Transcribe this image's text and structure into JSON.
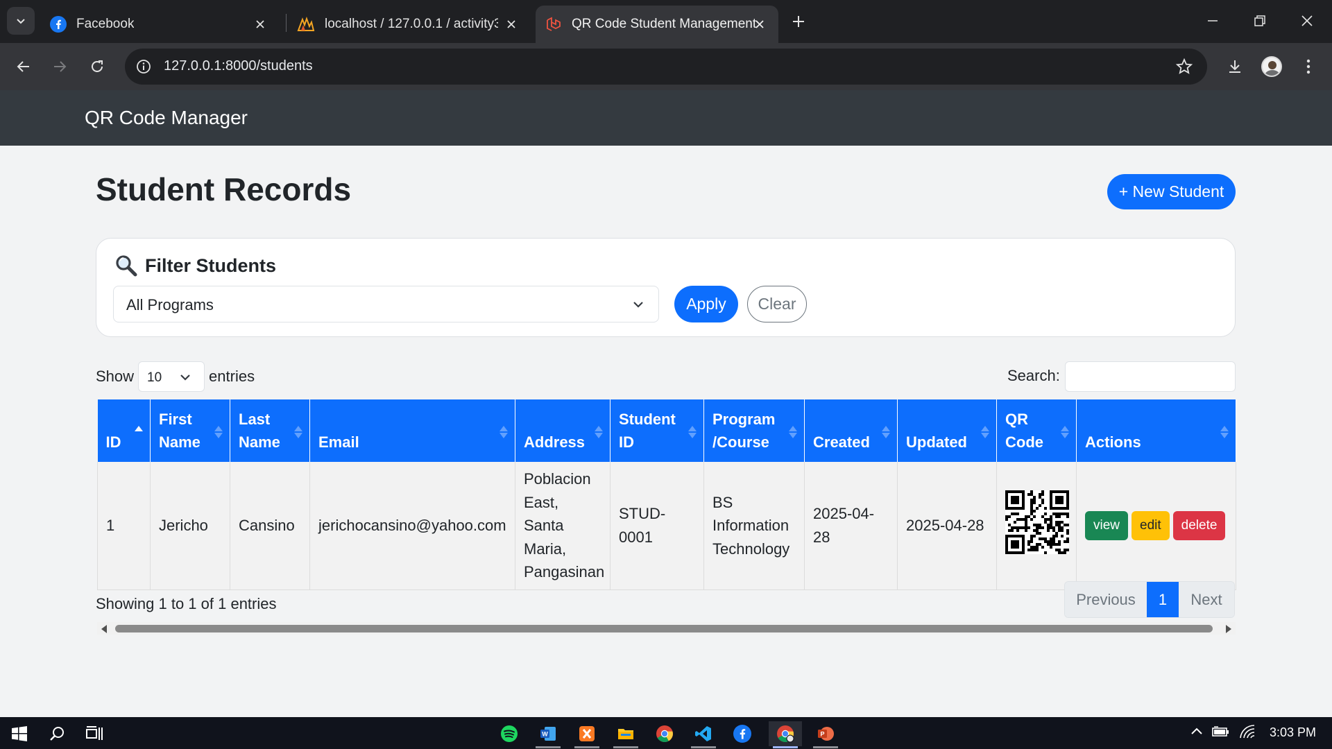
{
  "browser": {
    "tabs": [
      {
        "title": "Facebook",
        "icon": "facebook-icon"
      },
      {
        "title": "localhost / 127.0.0.1 / activity3_",
        "icon": "phpmyadmin-icon"
      },
      {
        "title": "QR Code Student Management",
        "icon": "laravel-icon",
        "active": true
      }
    ],
    "url": "127.0.0.1:8000/students"
  },
  "app": {
    "brand": "QR Code Manager",
    "page_title": "Student Records",
    "new_button": "+ New Student",
    "filter": {
      "title": "Filter Students",
      "icon": "magnifier-icon",
      "program_selected": "All Programs",
      "apply_label": "Apply",
      "clear_label": "Clear"
    },
    "length": {
      "show_label": "Show",
      "value": "10",
      "entries_label": "entries"
    },
    "search_label": "Search:",
    "table": {
      "columns": [
        {
          "line1": "",
          "line2": "ID"
        },
        {
          "line1": "First",
          "line2": "Name"
        },
        {
          "line1": "Last",
          "line2": "Name"
        },
        {
          "line1": "",
          "line2": "Email"
        },
        {
          "line1": "",
          "line2": "Address"
        },
        {
          "line1": "Student",
          "line2": "ID"
        },
        {
          "line1": "Program",
          "line2": "/Course"
        },
        {
          "line1": "",
          "line2": "Created"
        },
        {
          "line1": "",
          "line2": "Updated"
        },
        {
          "line1": "QR",
          "line2": "Code"
        },
        {
          "line1": "",
          "line2": "Actions"
        }
      ],
      "rows": [
        {
          "id": "1",
          "first_name": "Jericho",
          "last_name": "Cansino",
          "email": "jerichocansino@yahoo.com",
          "address": "Poblacion East, Santa Maria, Pangasinan",
          "student_id": "STUD-0001",
          "program": "BS Information Technology",
          "created": "2025-04-28",
          "updated": "2025-04-28",
          "actions": {
            "view": "view",
            "edit": "edit",
            "delete": "delete"
          }
        }
      ]
    },
    "info": "Showing 1 to 1 of 1 entries",
    "pager": {
      "previous": "Previous",
      "current": "1",
      "next": "Next"
    }
  },
  "colors": {
    "primary": "#0d6efd",
    "navbar": "#343a40",
    "success": "#198754",
    "warning": "#ffc107",
    "danger": "#dc3545"
  },
  "taskbar": {
    "clock": "3:03 PM"
  }
}
